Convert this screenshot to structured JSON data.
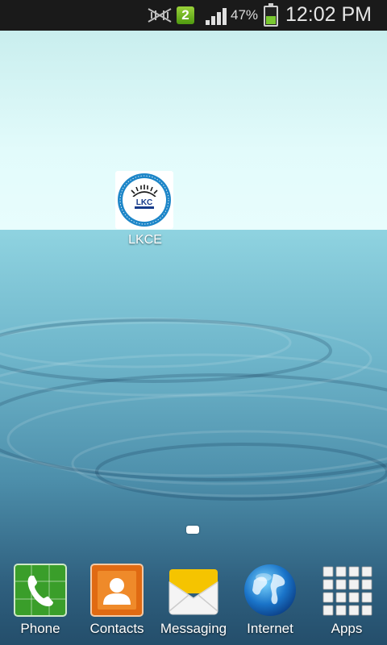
{
  "status_bar": {
    "sim_slot": "2",
    "battery_percent": "47%",
    "battery_level": 0.47,
    "time": "12:02 PM",
    "icons": [
      "no-signal-icon",
      "sim-icon",
      "signal-strength-icon",
      "battery-icon"
    ]
  },
  "home": {
    "shortcuts": [
      {
        "label": "LKCE",
        "icon": "lkce-logo-icon",
        "logo_text": "LKC"
      }
    ],
    "page_indicator": {
      "current": 1,
      "total": 1
    }
  },
  "dock": {
    "items": [
      {
        "label": "Phone",
        "icon": "phone-icon"
      },
      {
        "label": "Contacts",
        "icon": "contacts-icon"
      },
      {
        "label": "Messaging",
        "icon": "messaging-icon"
      },
      {
        "label": "Internet",
        "icon": "internet-icon"
      },
      {
        "label": "Apps",
        "icon": "apps-grid-icon"
      }
    ]
  },
  "colors": {
    "status_bar": "#1a1a1a",
    "battery_fill": "#7ac831",
    "sim_badge": "#6cb521",
    "phone_green": "#3a9e2a",
    "contacts_orange": "#e06a12",
    "messaging_yellow": "#f5c400",
    "internet_blue": "#1a74c9"
  }
}
